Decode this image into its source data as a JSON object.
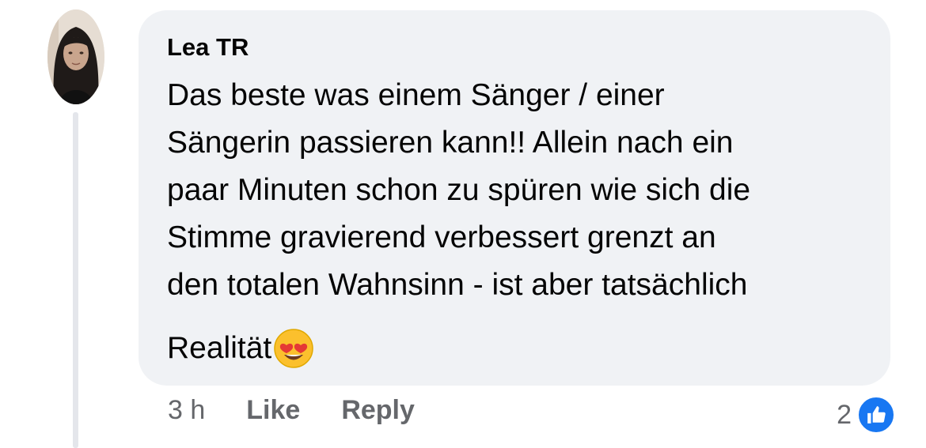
{
  "comment": {
    "author": "Lea TR",
    "text_lines": [
      "Das beste was einem Sänger / einer",
      "Sängerin passieren kann!! Allein nach ein",
      "paar Minuten schon zu spüren wie sich die",
      "Stimme gravierend verbessert grenzt an",
      "den totalen Wahnsinn - ist aber tatsächlich"
    ],
    "last_line": "Realität",
    "emoji": "smiling-face-with-heart-eyes",
    "timestamp": "3 h",
    "like_label": "Like",
    "reply_label": "Reply",
    "reaction_count": "2",
    "reaction_icon": "thumbs-up-icon"
  },
  "colors": {
    "bubble_bg": "#f0f2f5",
    "meta_text": "#65676b",
    "like_blue": "#1877f2"
  }
}
